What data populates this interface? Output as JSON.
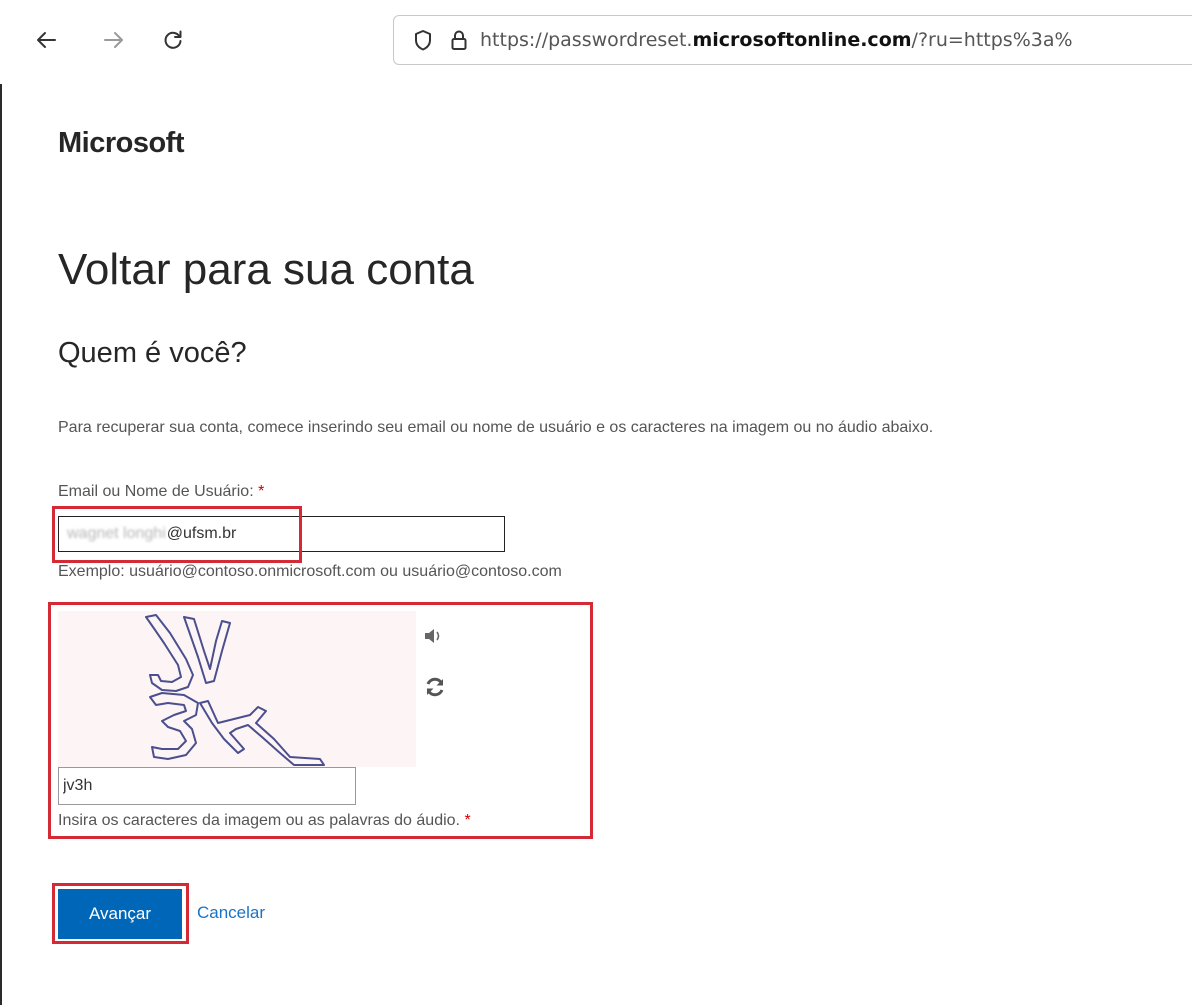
{
  "browser": {
    "url_prefix": "https://passwordreset.",
    "url_domain": "microsoftonline.com",
    "url_suffix": "/?ru=https%3a%"
  },
  "page": {
    "brand": "Microsoft",
    "title": "Voltar para sua conta",
    "subtitle": "Quem é você?",
    "intro": "Para recuperar sua conta, comece inserindo seu email ou nome de usuário e os caracteres na imagem ou no áudio abaixo."
  },
  "email_field": {
    "label": "Email ou Nome de Usuário:",
    "required_mark": "*",
    "value_obscured": "wagnet longhi",
    "value_domain": "@ufsm.br",
    "hint": "Exemplo: usuário@contoso.onmicrosoft.com ou usuário@contoso.com"
  },
  "captcha": {
    "characters": "JV3H",
    "input_value": "jv3h",
    "note": "Insira os caracteres da imagem ou as palavras do áudio.",
    "required_mark": "*",
    "audio_icon": "speaker-icon",
    "refresh_icon": "refresh-icon"
  },
  "actions": {
    "next_label": "Avançar",
    "cancel_label": "Cancelar"
  },
  "colors": {
    "primary_button": "#0067b8",
    "link": "#1a73c6",
    "highlight": "#d42a36"
  }
}
